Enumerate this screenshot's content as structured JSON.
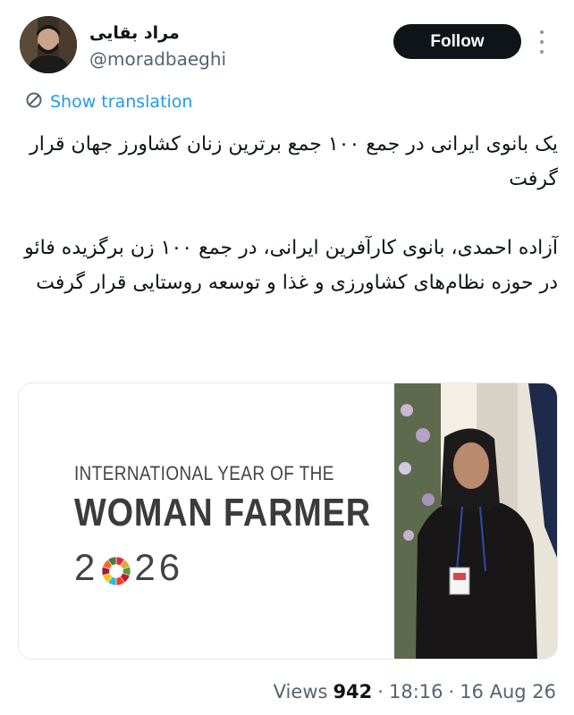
{
  "user": {
    "display_name": "مراد بقایی",
    "handle": "@moradbaeghi",
    "avatar_icon": "avatar"
  },
  "header": {
    "follow_label": "Follow",
    "more_icon": "more-vertical-icon"
  },
  "translation": {
    "label": "Show translation",
    "icon": "translate-icon",
    "color": "#1d9bf0"
  },
  "tweet": {
    "paragraph1": "یک بانوی ایرانی در جمع ۱۰۰ جمع برترین زنان کشاورز جهان قرار گرفت",
    "paragraph2": "آزاده احمدی، بانوی کارآفرین ایرانی، در جمع ۱۰۰ زن برگزیده فائو در حوزه نظام‌های کشاورزی و غذا و توسعه روستایی قرار گرفت"
  },
  "media": {
    "line1": "INTERNATIONAL YEAR OF THE",
    "line2": "WOMAN FARMER",
    "year_prefix": "2",
    "year_suffix": "26",
    "sdg_icon": "sdg-wheel-icon"
  },
  "meta": {
    "views_label": "Views",
    "views_count": "942",
    "time": "18:16",
    "date": "16 Aug 26",
    "separator": "·"
  },
  "colors": {
    "text": "#0f1419",
    "secondary": "#536471",
    "button_bg": "#0f1419",
    "link": "#1d9bf0"
  }
}
